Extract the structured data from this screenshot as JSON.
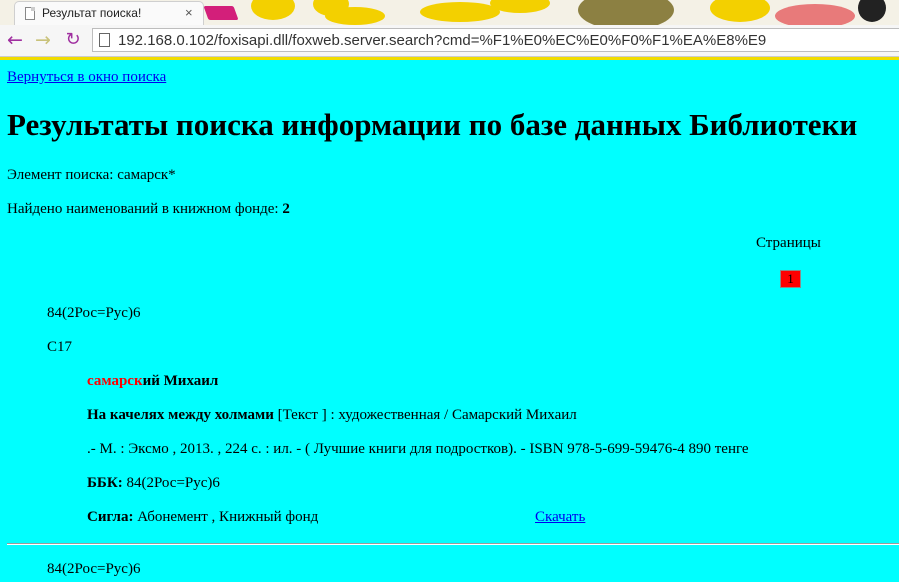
{
  "browser": {
    "tab_title": "Результат поиска!",
    "tab_close": "×",
    "url": "192.168.0.102/foxisapi.dll/foxweb.server.search?cmd=%F1%E0%EC%E0%F0%F1%EA%E8%E9",
    "back_glyph": "←",
    "forward_glyph": "→",
    "reload_glyph": "↻"
  },
  "page": {
    "back_link": "Вернуться в окно поиска",
    "title": "Результаты поиска информации по базе данных Библиотеки",
    "search_label": "Элемент поиска: ",
    "search_term": "самарск*",
    "found_label": "Найдено наименований в книжном фонде: ",
    "found_count": "2",
    "pages_label": "Страницы",
    "current_page": "1"
  },
  "records": [
    {
      "class_code": "84(2Рос=Рус)6",
      "author_mark": "С17",
      "author_highlight": "самарск",
      "author_rest": "ий Михаил",
      "book_title": "На качелях между холмами",
      "description": " [Текст ] : художественная  / Самарский Михаил",
      "publication": ".- М. : Эксмо  , 2013. , 224 с.  : ил. - ( Лучшие книги для подростков).  - ISBN 978-5-699-59476-4  890 тенге",
      "bbk_label": "ББК:",
      "bbk_value": " 84(2Рос=Рус)6",
      "sigla_label": "Сигла:",
      "sigla_value": " Абонемент , Книжный фонд",
      "download_label": "Скачать"
    },
    {
      "class_code": "84(2Рос=Рус)6"
    }
  ],
  "colors": {
    "page_background": "#00ffff",
    "highlight": "#ff0000",
    "link": "#0000ee",
    "current_page_bg": "#ff0000"
  }
}
